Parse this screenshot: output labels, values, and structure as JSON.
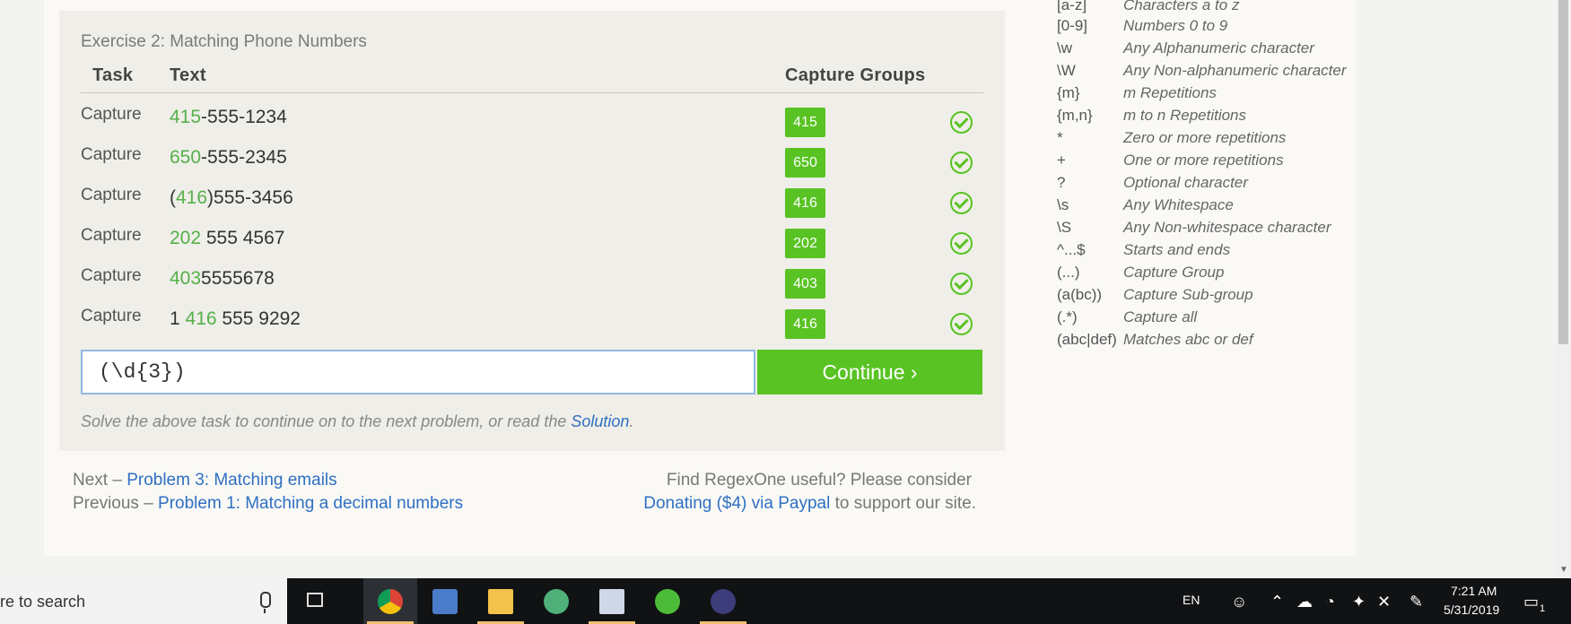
{
  "exercise": {
    "title": "Exercise 2: Matching Phone Numbers",
    "headers": {
      "task": "Task",
      "text": "Text",
      "capture_groups": "Capture Groups"
    },
    "rows": [
      {
        "task": "Capture",
        "pre": "",
        "hl": "415",
        "post": "-555-1234",
        "group": "415"
      },
      {
        "task": "Capture",
        "pre": "",
        "hl": "650",
        "post": "-555-2345",
        "group": "650"
      },
      {
        "task": "Capture",
        "pre": "(",
        "hl": "416",
        "post": ")555-3456",
        "group": "416"
      },
      {
        "task": "Capture",
        "pre": "",
        "hl": "202",
        "post": " 555 4567",
        "group": "202"
      },
      {
        "task": "Capture",
        "pre": "",
        "hl": "403",
        "post": "5555678",
        "group": "403"
      },
      {
        "task": "Capture",
        "pre": "1 ",
        "hl": "416",
        "post": " 555 9292",
        "group": "416"
      }
    ],
    "input_value": "(\\d{3})",
    "continue_label": "Continue ›",
    "hint_prefix": "Solve the above task to continue on to the next problem, or read the ",
    "hint_link": "Solution",
    "hint_suffix": "."
  },
  "footer": {
    "next_label": "Next – ",
    "next_link": "Problem 3: Matching emails",
    "prev_label": "Previous – ",
    "prev_link": "Problem 1: Matching a decimal numbers",
    "donate_text": "Find RegexOne useful? Please consider",
    "donate_link": "Donating ($4) via Paypal",
    "donate_suffix": " to support our site."
  },
  "cheatsheet": [
    {
      "token": "[a-z]",
      "desc": "Characters a to z"
    },
    {
      "token": "[0-9]",
      "desc": "Numbers 0 to 9"
    },
    {
      "token": "\\w",
      "desc": "Any Alphanumeric character"
    },
    {
      "token": "\\W",
      "desc": "Any Non-alphanumeric character"
    },
    {
      "token": "{m}",
      "desc": "m Repetitions"
    },
    {
      "token": "{m,n}",
      "desc": "m to n Repetitions"
    },
    {
      "token": "*",
      "desc": "Zero or more repetitions"
    },
    {
      "token": "+",
      "desc": "One or more repetitions"
    },
    {
      "token": "?",
      "desc": "Optional character"
    },
    {
      "token": "\\s",
      "desc": "Any Whitespace"
    },
    {
      "token": "\\S",
      "desc": "Any Non-whitespace character"
    },
    {
      "token": "^...$",
      "desc": "Starts and ends"
    },
    {
      "token": "(...)",
      "desc": "Capture Group"
    },
    {
      "token": "(a(bc))",
      "desc": "Capture Sub-group"
    },
    {
      "token": "(.*)",
      "desc": "Capture all"
    },
    {
      "token": "(abc|def)",
      "desc": "Matches abc or def"
    }
  ],
  "taskbar": {
    "search_text": "re to search",
    "lang": "EN",
    "time": "7:21 AM",
    "date": "5/31/2019",
    "notification_count": "1"
  },
  "colors": {
    "accent_green": "#58c322",
    "highlight_green": "#55b04a",
    "link_blue": "#2f6fc2"
  }
}
